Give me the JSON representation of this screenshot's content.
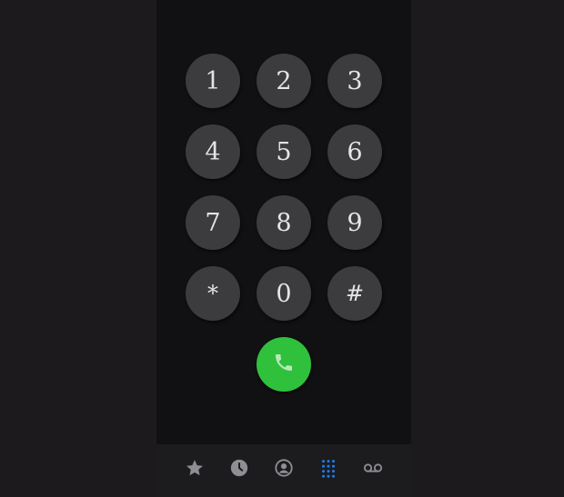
{
  "keypad": {
    "keys": [
      {
        "label": "1"
      },
      {
        "label": "2"
      },
      {
        "label": "3"
      },
      {
        "label": "4"
      },
      {
        "label": "5"
      },
      {
        "label": "6"
      },
      {
        "label": "7"
      },
      {
        "label": "8"
      },
      {
        "label": "9"
      },
      {
        "label": "*"
      },
      {
        "label": "0"
      },
      {
        "label": "#"
      }
    ]
  },
  "call_button": {
    "icon": "phone-icon",
    "color": "#2fc13c"
  },
  "tabbar": {
    "active_color": "#1f7ae0",
    "inactive_color": "#8e8e93",
    "tabs": [
      {
        "icon": "star-icon",
        "active": false
      },
      {
        "icon": "clock-icon",
        "active": false
      },
      {
        "icon": "contact-icon",
        "active": false
      },
      {
        "icon": "keypad-icon",
        "active": true
      },
      {
        "icon": "voicemail-icon",
        "active": false
      }
    ]
  }
}
